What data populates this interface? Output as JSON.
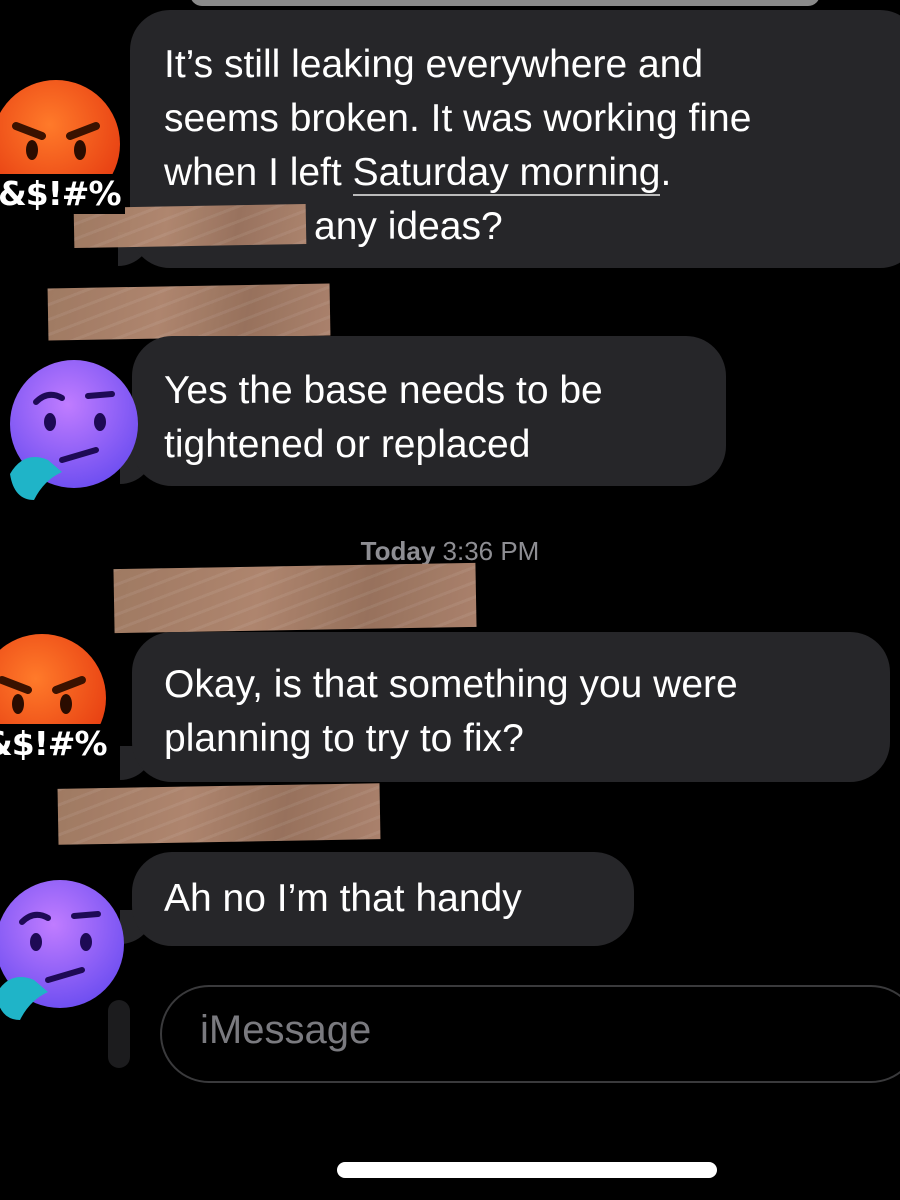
{
  "messages": [
    {
      "sender": "angry-contact",
      "lines": [
        "It’s still leaking everywhere and",
        "seems broken. It was working fine",
        "when I left ",
        "any ideas?"
      ],
      "link_text": "Saturday morning",
      "link_suffix": "."
    },
    {
      "sender": "thinking-contact",
      "lines": [
        "Yes the base needs to be",
        "tightened or replaced"
      ]
    },
    {
      "sender": "angry-contact",
      "lines": [
        "Okay, is that something you were",
        "planning to try to fix?"
      ]
    },
    {
      "sender": "thinking-contact",
      "lines": [
        "Ah no I’m that handy"
      ]
    }
  ],
  "timestamp": {
    "day": "Today",
    "time": "3:36 PM"
  },
  "avatars": {
    "angry_label": "&$!#%",
    "angry_label_2": "&$!#%"
  },
  "compose": {
    "placeholder": "iMessage"
  },
  "icons": {
    "angry": "angry-face-emoji",
    "thinking": "thinking-face-emoji"
  },
  "colors": {
    "background": "#000000",
    "bubble": "#262629",
    "timestamp": "#8e8e93",
    "tape": "#a57e66"
  }
}
